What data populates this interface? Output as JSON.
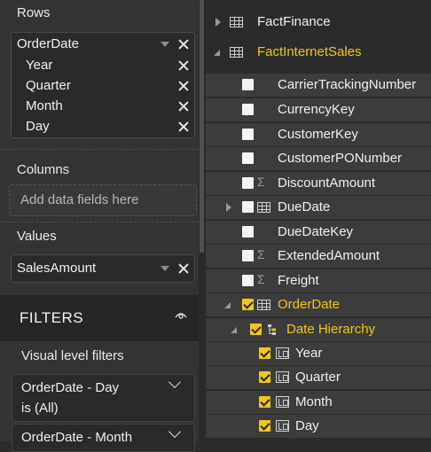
{
  "fields_pane": {
    "rows": {
      "label": "Rows",
      "field": "OrderDate",
      "levels": [
        "Year",
        "Quarter",
        "Month",
        "Day"
      ]
    },
    "columns": {
      "label": "Columns",
      "placeholder": "Add data fields here"
    },
    "values": {
      "label": "Values",
      "field": "SalesAmount"
    }
  },
  "filters": {
    "title": "FILTERS",
    "visual_level_label": "Visual level filters",
    "cards": [
      {
        "line1": "OrderDate - Day",
        "line2": "is (All)"
      },
      {
        "line1": "OrderDate - Month",
        "line2": ""
      }
    ]
  },
  "field_list": {
    "tables": [
      {
        "name": "FactFinance",
        "expanded": false
      },
      {
        "name": "FactInternetSales",
        "expanded": true
      }
    ],
    "fields": [
      {
        "name": "CarrierTrackingNumber",
        "checked": false,
        "type": "text"
      },
      {
        "name": "CurrencyKey",
        "checked": false,
        "type": "text"
      },
      {
        "name": "CustomerKey",
        "checked": false,
        "type": "text"
      },
      {
        "name": "CustomerPONumber",
        "checked": false,
        "type": "text"
      },
      {
        "name": "DiscountAmount",
        "checked": false,
        "type": "sum"
      },
      {
        "name": "DueDate",
        "checked": false,
        "type": "date"
      },
      {
        "name": "DueDateKey",
        "checked": false,
        "type": "text"
      },
      {
        "name": "ExtendedAmount",
        "checked": false,
        "type": "sum"
      },
      {
        "name": "Freight",
        "checked": false,
        "type": "sum"
      },
      {
        "name": "OrderDate",
        "checked": true,
        "type": "date"
      }
    ],
    "hierarchy": {
      "name": "Date Hierarchy",
      "checked": true,
      "levels": [
        {
          "name": "Year",
          "checked": true
        },
        {
          "name": "Quarter",
          "checked": true
        },
        {
          "name": "Month",
          "checked": true
        },
        {
          "name": "Day",
          "checked": true
        }
      ]
    }
  },
  "colors": {
    "accent": "#f2c80f",
    "panel": "#333333",
    "band": "#3c3c3c"
  }
}
